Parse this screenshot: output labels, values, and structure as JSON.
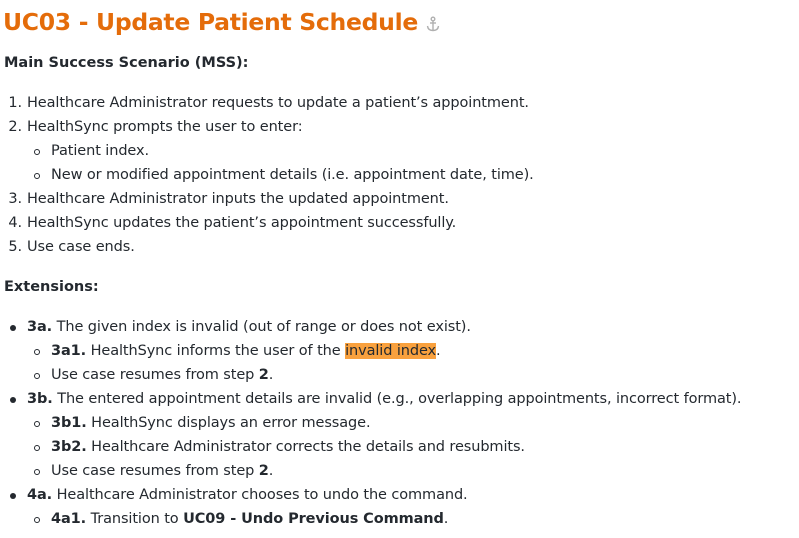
{
  "title": "UC03 - Update Patient Schedule",
  "mss": {
    "heading": "Main Success Scenario (MSS):",
    "steps": [
      {
        "num": "1.",
        "text": "Healthcare Administrator requests to update a patient’s appointment."
      },
      {
        "num": "2.",
        "text": "HealthSync prompts the user to enter:"
      },
      {
        "sub1": "Patient index.",
        "sub2": "New or modified appointment details (i.e. appointment date, time)."
      },
      {
        "num": "3.",
        "text": "Healthcare Administrator inputs the updated appointment."
      },
      {
        "num": "4.",
        "text": "HealthSync updates the patient’s appointment successfully."
      },
      {
        "num": "5.",
        "text": "Use case ends."
      }
    ]
  },
  "extensions": {
    "heading": "Extensions:",
    "e3a": {
      "label": "3a.",
      "text": " The given index is invalid (out of range or does not exist)."
    },
    "e3a1": {
      "label": "3a1.",
      "text": " HealthSync informs the user of the ",
      "highlight": "invalid index",
      "tail": "."
    },
    "e3a_resume": {
      "text": "Use case resumes from step ",
      "step": "2",
      "tail": "."
    },
    "e3b": {
      "label": "3b.",
      "text": " The entered appointment details are invalid (e.g., overlapping appointments, incorrect format)."
    },
    "e3b1": {
      "label": "3b1.",
      "text": " HealthSync displays an error message."
    },
    "e3b2": {
      "label": "3b2.",
      "text": " Healthcare Administrator corrects the details and resubmits."
    },
    "e3b_resume": {
      "text": "Use case resumes from step ",
      "step": "2",
      "tail": "."
    },
    "e4a": {
      "label": "4a.",
      "text": " Healthcare Administrator chooses to undo the command."
    },
    "e4a1": {
      "label": "4a1.",
      "text": " Transition to ",
      "ref": "UC09 - Undo Previous Command",
      "tail": "."
    }
  },
  "icons": {
    "anchor": "anchor-icon"
  },
  "colors": {
    "title": "#e46c0a",
    "highlight": "#f9a13e"
  }
}
